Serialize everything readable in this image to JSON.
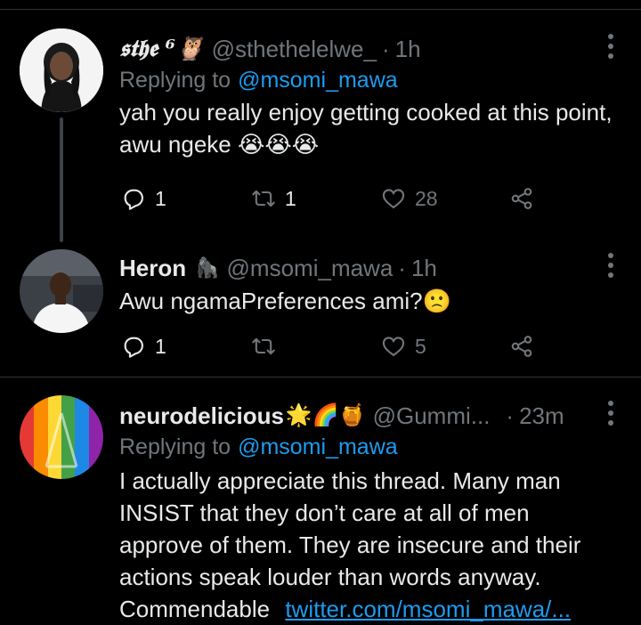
{
  "tweets": [
    {
      "display_name": "𝖘𝖙𝖍𝖊 ⁶🦉",
      "handle": "@sthethelelwe_",
      "dot": "·",
      "time": "1h",
      "replying_prefix": "Replying to",
      "replying_to": "@msomi_mawa",
      "text": "yah you really enjoy getting cooked at this point, awu ngeke 😭😭😭",
      "reply_count": "1",
      "retweet_count": "1",
      "like_count": "28"
    },
    {
      "display_name": "Heron",
      "name_emoji": "🦍",
      "handle": "@msomi_mawa",
      "dot": "·",
      "time": "1h",
      "text": "Awu ngamaPreferences ami?🙁",
      "reply_count": "1",
      "retweet_count": "",
      "like_count": "5"
    },
    {
      "display_name": "neurodelicious",
      "name_emoji": "🌟🌈🍯",
      "handle": "@Gummi...",
      "dot": "·",
      "time": "23m",
      "replying_prefix": "Replying to",
      "replying_to": "@msomi_mawa",
      "text_lines": [
        "I actually appreciate this thread. Many man",
        "INSIST that they don’t care at all of men",
        "approve of them. They are insecure and their",
        "actions speak louder than words anyway."
      ],
      "text_tail": "Commendable",
      "text_link": "twitter.com/msomi_mawa/..."
    }
  ],
  "colors": {
    "background": "#000000",
    "text": "#e7e9ea",
    "muted": "#71767b",
    "link": "#1d9bf0",
    "divider": "#2f3336"
  },
  "icons": [
    "more-icon",
    "reply-icon",
    "retweet-icon",
    "like-icon",
    "share-icon"
  ]
}
